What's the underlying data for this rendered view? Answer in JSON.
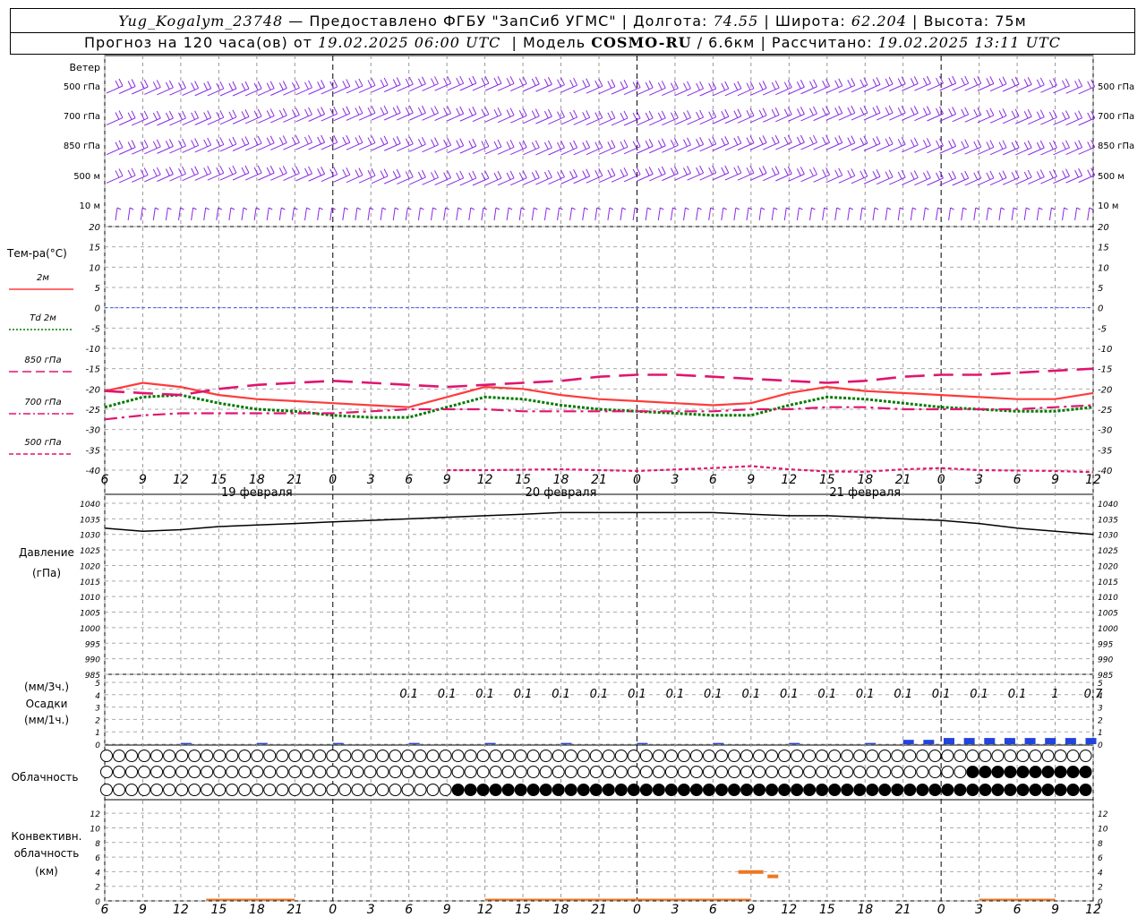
{
  "header": {
    "station": "Yug_Kogalym_23748",
    "provider": " — Предоставлено ФГБУ \"ЗапСиб УГМС\" | Долгота: ",
    "lon": "74.55",
    "lat_label": " | Широта: ",
    "lat": "62.204",
    "alt_label": " | Высота: 75м",
    "forecast_prefix": "Прогноз на 120 часа(ов) от ",
    "init_time": "19.02.2025 06:00 UTC",
    "model_label": "  | Модель ",
    "model": "COSMO-RU",
    "resolution": " / 6.6км",
    "calc_label": " | Рассчитано: ",
    "calc_time": "19.02.2025 13:11 UTC"
  },
  "time_axis": {
    "hour_labels": [
      "6",
      "9",
      "12",
      "15",
      "18",
      "21",
      "0",
      "3",
      "6",
      "9",
      "12",
      "15",
      "18",
      "21",
      "0",
      "3",
      "6",
      "9",
      "12",
      "15",
      "18",
      "21",
      "0",
      "3",
      "6",
      "9",
      "12"
    ],
    "day_labels": [
      "19 февраля",
      "20 февраля",
      "21 февраля"
    ]
  },
  "panels": {
    "wind": {
      "title": "Ветер",
      "levels": [
        "500 гПа",
        "700 гПа",
        "850 гПа",
        "500 м",
        "10  м"
      ],
      "right_levels": [
        "500 гПа",
        "700 гПа",
        "850 гПа",
        "500 м",
        "10  м"
      ],
      "color": "#8a2be2"
    },
    "temperature": {
      "title": "Тем-ра(°С)",
      "legend": [
        {
          "label": "2м",
          "style": "solid",
          "color": "#ff3b3b"
        },
        {
          "label": "Td  2м",
          "style": "dotted",
          "color": "#007a00"
        },
        {
          "label": "850 гПа",
          "style": "long-dash",
          "color": "#e0156f"
        },
        {
          "label": "700 гПа",
          "style": "dash-dot",
          "color": "#e0156f"
        },
        {
          "label": "500 гПа",
          "style": "short-dash",
          "color": "#e0156f"
        }
      ],
      "ticks": [
        "20",
        "15",
        "10",
        "5",
        "0",
        "-5",
        "-10",
        "-15",
        "-20",
        "-25",
        "-30",
        "-35",
        "-40"
      ]
    },
    "pressure": {
      "title": "Давление",
      "unit": "(гПа)",
      "ticks": [
        "1040",
        "1035",
        "1030",
        "1025",
        "1020",
        "1015",
        "1010",
        "1005",
        "1000",
        "995",
        "990",
        "985"
      ]
    },
    "precip": {
      "title_3h": "(мм/3ч.)",
      "title": "Осадки",
      "title_1h": "(мм/1ч.)",
      "ticks": [
        "5",
        "4",
        "3",
        "2",
        "1",
        "0"
      ],
      "labels": [
        "0.1",
        "0.1",
        "0.1",
        "0.1",
        "0.1",
        "0.1",
        "0.1",
        "0.1",
        "0.1",
        "0.1",
        "0.1",
        "0.1",
        "0.1",
        "0.1",
        "0.1",
        "0.1",
        "0.1",
        "1",
        "0.7"
      ]
    },
    "clouds": {
      "title": "Облачность"
    },
    "convective": {
      "title1": "Конвективн.",
      "title2": "облачность",
      "title3": "(км)",
      "ticks": [
        "12",
        "10",
        "8",
        "6",
        "4",
        "2",
        "0"
      ]
    }
  },
  "chart_data": [
    {
      "type": "line",
      "name": "temperature",
      "x_unit": "forecast hour",
      "x": [
        0,
        3,
        6,
        9,
        12,
        15,
        18,
        21,
        24,
        27,
        30,
        33,
        36,
        39,
        42,
        45,
        48,
        51,
        54,
        57,
        60,
        63,
        66,
        69,
        72,
        75,
        78
      ],
      "ylim": [
        -40,
        20
      ],
      "series": [
        {
          "name": "2м",
          "values": [
            -20.5,
            -18.5,
            -19.5,
            -21.5,
            -22.5,
            -23,
            -23.5,
            -24,
            -24.5,
            -22,
            -19.5,
            -20,
            -21.5,
            -22.5,
            -23,
            -23.5,
            -24,
            -23.5,
            -21,
            -19.5,
            -20.5,
            -21,
            -21.5,
            -22,
            -22.5,
            -22.5,
            -21
          ]
        },
        {
          "name": "Td  2м",
          "values": [
            -24.5,
            -22,
            -21.5,
            -23.5,
            -25,
            -25.5,
            -26.5,
            -27,
            -27,
            -24.5,
            -22,
            -22.5,
            -24,
            -25,
            -25.5,
            -26,
            -26.5,
            -26.5,
            -24,
            -22,
            -22.5,
            -23.5,
            -24.5,
            -25,
            -25.5,
            -25.5,
            -24.5
          ]
        },
        {
          "name": "850 гПа",
          "values": [
            -20.5,
            -21,
            -21.5,
            -20,
            -19,
            -18.5,
            -18,
            -18.5,
            -19,
            -19.5,
            -19,
            -18.5,
            -18,
            -17,
            -16.5,
            -16.5,
            -17,
            -17.5,
            -18,
            -18.5,
            -18,
            -17,
            -16.5,
            -16.5,
            -16,
            -15.5,
            -15
          ]
        },
        {
          "name": "700 гПа",
          "values": [
            -27.5,
            -26.5,
            -26,
            -26,
            -26,
            -26,
            -26,
            -25.5,
            -25,
            -25,
            -25,
            -25.5,
            -25.5,
            -25.5,
            -25.5,
            -25.5,
            -25.5,
            -25,
            -25,
            -24.5,
            -24.5,
            -25,
            -25,
            -25,
            -25,
            -24.5,
            -24
          ]
        },
        {
          "name": "500 гПа",
          "values": []
        }
      ]
    },
    {
      "type": "line",
      "name": "pressure",
      "x_unit": "forecast hour",
      "ylim": [
        985,
        1040
      ],
      "x": [
        0,
        3,
        6,
        9,
        12,
        15,
        18,
        21,
        24,
        27,
        30,
        33,
        36,
        39,
        42,
        45,
        48,
        51,
        54,
        57,
        60,
        63,
        66,
        69,
        72,
        75,
        78
      ],
      "values": [
        1032,
        1031,
        1031.5,
        1032.5,
        1033,
        1033.5,
        1034,
        1034.5,
        1035,
        1035.5,
        1036,
        1036.5,
        1037,
        1037,
        1037,
        1037,
        1037,
        1036.5,
        1036,
        1036,
        1035.5,
        1035,
        1034.5,
        1033.5,
        1032,
        1031,
        1030
      ]
    },
    {
      "type": "bar",
      "name": "precipitation",
      "ylim": [
        0,
        5
      ],
      "note_values_mm_3h": [
        "0.1",
        "0.1",
        "0.1",
        "0.1",
        "0.1",
        "0.1",
        "0.1",
        "0.1",
        "0.1",
        "0.1",
        "0.1",
        "0.1",
        "0.1",
        "0.1",
        "0.1",
        "0.1",
        "0.1",
        "1",
        "0.7"
      ]
    },
    {
      "type": "bar",
      "name": "convective cloud",
      "ylim": [
        0,
        13
      ]
    }
  ],
  "wind_rows": 5
}
